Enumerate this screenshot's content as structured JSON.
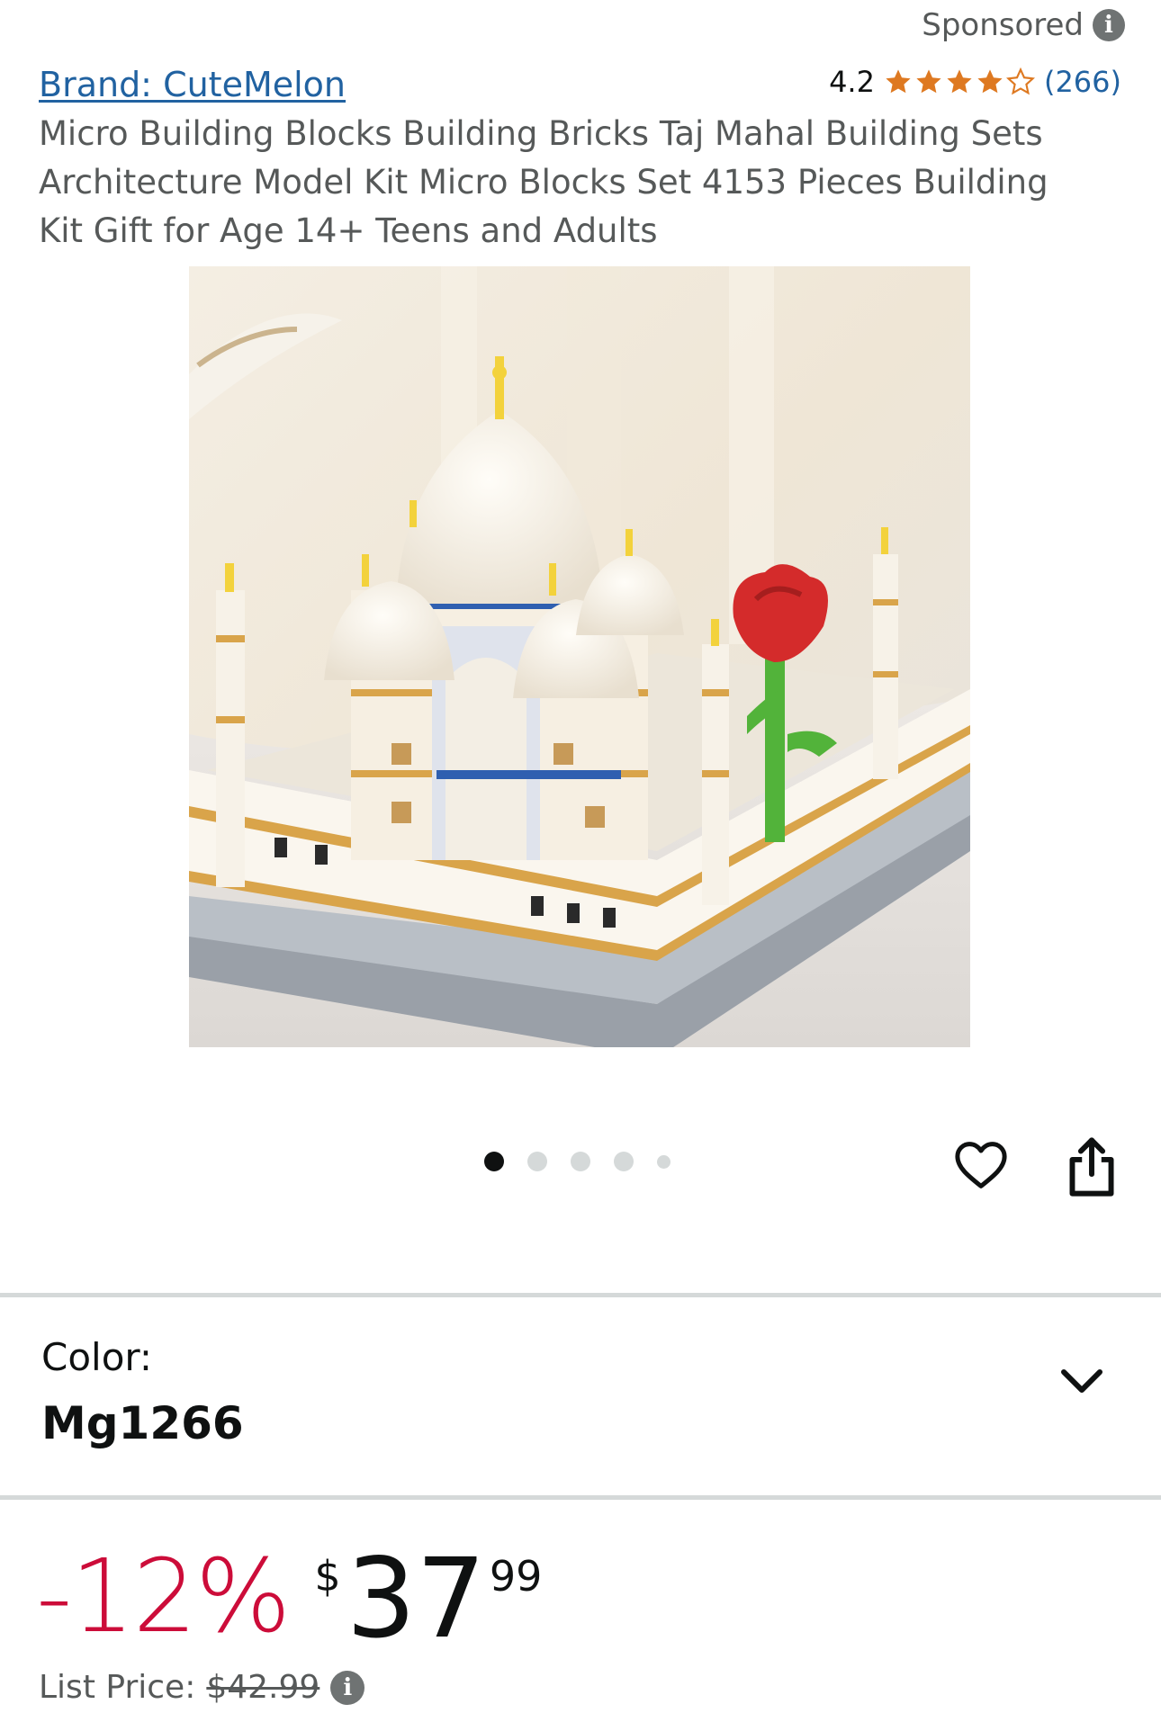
{
  "header": {
    "sponsored_label": "Sponsored",
    "info_icon": "i"
  },
  "product": {
    "brand_link": "Brand: CuteMelon",
    "rating": {
      "score": "4.2",
      "stars_filled": 4.2,
      "stars_total": 5,
      "count": "(266)",
      "star_color": "#de7921"
    },
    "title": "Micro Building Blocks Building Bricks Taj Mahal Building Sets Architecture Model Kit Micro Blocks Set 4153 Pieces Building Kit Gift for Age 14+ Teens and Adults"
  },
  "gallery": {
    "image_alt": "Taj Mahal micro building blocks model",
    "dots_count": 5,
    "active_dot": 0
  },
  "actions": {
    "favorite_icon": "heart-icon",
    "share_icon": "share-icon"
  },
  "variant": {
    "label": "Color:",
    "value": "Mg1266"
  },
  "pricing": {
    "discount": "-12%",
    "currency": "$",
    "whole": "37",
    "fraction": "99",
    "list_price_label": "List Price:",
    "list_price_value": "$42.99",
    "discount_color": "#cc0c39"
  }
}
